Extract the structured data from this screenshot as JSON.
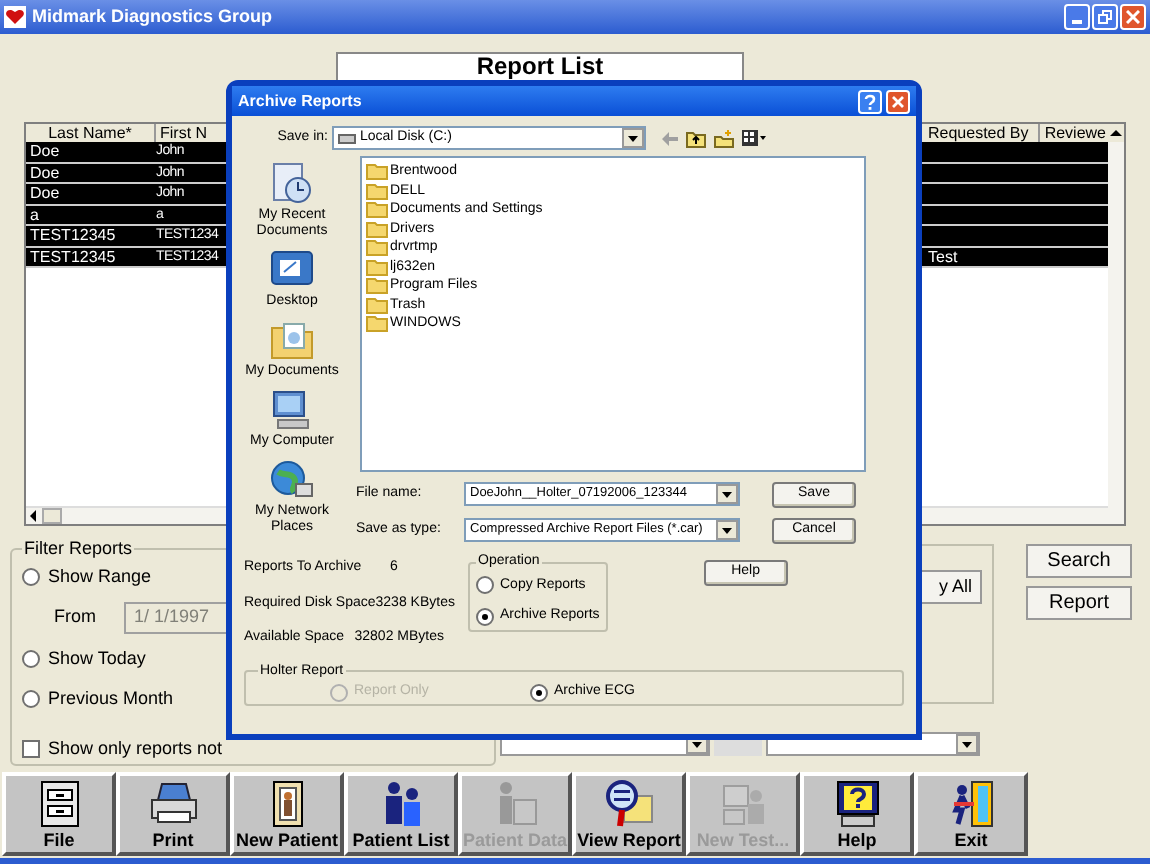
{
  "window": {
    "title": "Midmark Diagnostics Group"
  },
  "page_title": "Report List",
  "table": {
    "columns": [
      "Last Name*",
      "First N",
      "Requested By",
      "Reviewe"
    ],
    "rows": [
      {
        "last_name": "Doe",
        "first_name": "John",
        "selected": true
      },
      {
        "last_name": "Doe",
        "first_name": "John",
        "selected": true
      },
      {
        "last_name": "Doe",
        "first_name": "John",
        "selected": true
      },
      {
        "last_name": "a",
        "first_name": "a",
        "selected": true
      },
      {
        "last_name": "TEST12345",
        "first_name": "TEST1234",
        "selected": true
      },
      {
        "last_name": "TEST12345",
        "first_name": "TEST1234",
        "requested_by": "Test",
        "selected": true
      }
    ]
  },
  "filter": {
    "title": "Filter Reports",
    "items": [
      {
        "kind": "radio",
        "label": "Show Range",
        "selected": false
      },
      {
        "kind": "date",
        "label": "From",
        "value": "1/ 1/1997",
        "disabled": true
      },
      {
        "kind": "radio",
        "label": "Show Today",
        "selected": false
      },
      {
        "kind": "radio",
        "label": "Previous Month",
        "selected": false
      },
      {
        "kind": "checkbox",
        "label": "Show only reports not",
        "checked": false
      }
    ]
  },
  "middle_button": "y All",
  "side_buttons": [
    "Search",
    "Report"
  ],
  "toolbar": [
    {
      "label": "File",
      "disabled": false
    },
    {
      "label": "Print",
      "disabled": false
    },
    {
      "label": "New Patient",
      "disabled": false
    },
    {
      "label": "Patient List",
      "disabled": false
    },
    {
      "label": "Patient Data",
      "disabled": true
    },
    {
      "label": "View Report",
      "disabled": false
    },
    {
      "label": "New Test...",
      "disabled": true
    },
    {
      "label": "Help",
      "disabled": false
    },
    {
      "label": "Exit",
      "disabled": false
    }
  ],
  "dialog": {
    "title": "Archive Reports",
    "save_in": {
      "label": "Save in:",
      "value": "Local Disk (C:)"
    },
    "places": [
      "My Recent Documents",
      "Desktop",
      "My Documents",
      "My Computer",
      "My Network Places"
    ],
    "files": [
      "Brentwood",
      "DELL",
      "Documents and Settings",
      "Drivers",
      "drvrtmp",
      "lj632en",
      "Program Files",
      "Trash",
      "WINDOWS"
    ],
    "file_name": {
      "label": "File name:",
      "value": "DoeJohn__Holter_07192006_123344"
    },
    "save_as_type": {
      "label": "Save as type:",
      "value": "Compressed Archive Report Files (*.car)"
    },
    "buttons": [
      "Save",
      "Cancel",
      "Help"
    ],
    "info": [
      {
        "label": "Reports To Archive",
        "value": "6"
      },
      {
        "label": "Required Disk Space",
        "value": "3238 KBytes"
      },
      {
        "label": "Available Space",
        "value": "32802 MBytes"
      }
    ],
    "operation": {
      "title": "Operation",
      "options": [
        {
          "label": "Copy Reports",
          "selected": false
        },
        {
          "label": "Archive Reports",
          "selected": true
        }
      ]
    },
    "holter": {
      "title": "Holter Report",
      "options": [
        {
          "label": "Report Only",
          "selected": false,
          "disabled": true
        },
        {
          "label": "Archive ECG",
          "selected": true,
          "disabled": false
        }
      ]
    }
  }
}
